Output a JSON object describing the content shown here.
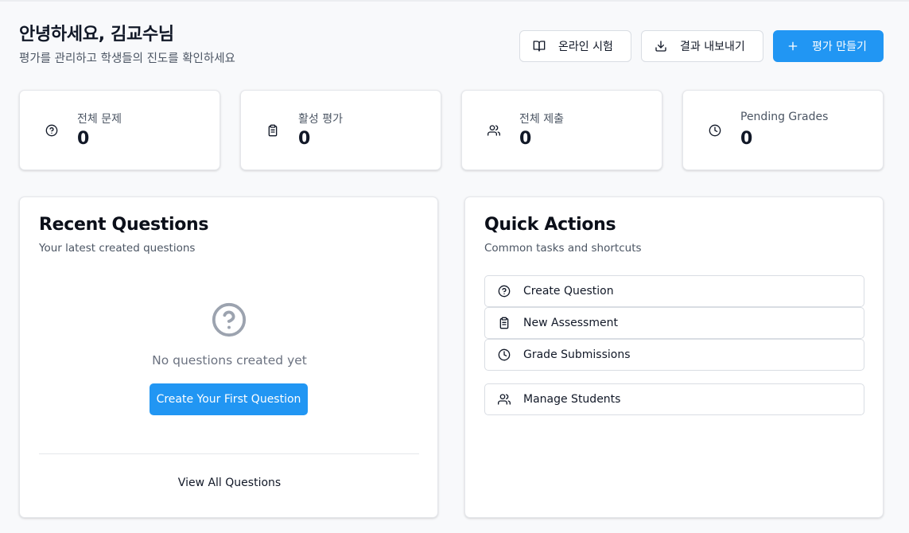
{
  "header": {
    "greeting": "안녕하세요, 김교수님",
    "subtitle": "평가를 관리하고 학생들의 진도를 확인하세요",
    "buttons": {
      "online_exam": "온라인 시험",
      "export_results": "결과 내보내기",
      "create_assessment": "평가 만들기"
    }
  },
  "stats": [
    {
      "label": "전체 문제",
      "value": "0",
      "icon": "help-circle-icon"
    },
    {
      "label": "활성 평가",
      "value": "0",
      "icon": "clipboard-icon"
    },
    {
      "label": "전체 제출",
      "value": "0",
      "icon": "users-icon"
    },
    {
      "label": "Pending Grades",
      "value": "0",
      "icon": "clock-icon"
    }
  ],
  "recent_questions": {
    "title": "Recent Questions",
    "subtitle": "Your latest created questions",
    "empty_text": "No questions created yet",
    "create_first_label": "Create Your First Question",
    "view_all_label": "View All Questions"
  },
  "quick_actions": {
    "title": "Quick Actions",
    "subtitle": "Common tasks and shortcuts",
    "items": [
      {
        "label": "Create Question",
        "icon": "help-circle-icon"
      },
      {
        "label": "New Assessment",
        "icon": "clipboard-icon"
      },
      {
        "label": "Grade Submissions",
        "icon": "clock-icon"
      },
      {
        "label": "Manage Students",
        "icon": "users-icon"
      }
    ]
  },
  "colors": {
    "primary": "#2196f3",
    "background": "#f8f9fb",
    "text": "#111827",
    "muted": "#4b5563"
  }
}
